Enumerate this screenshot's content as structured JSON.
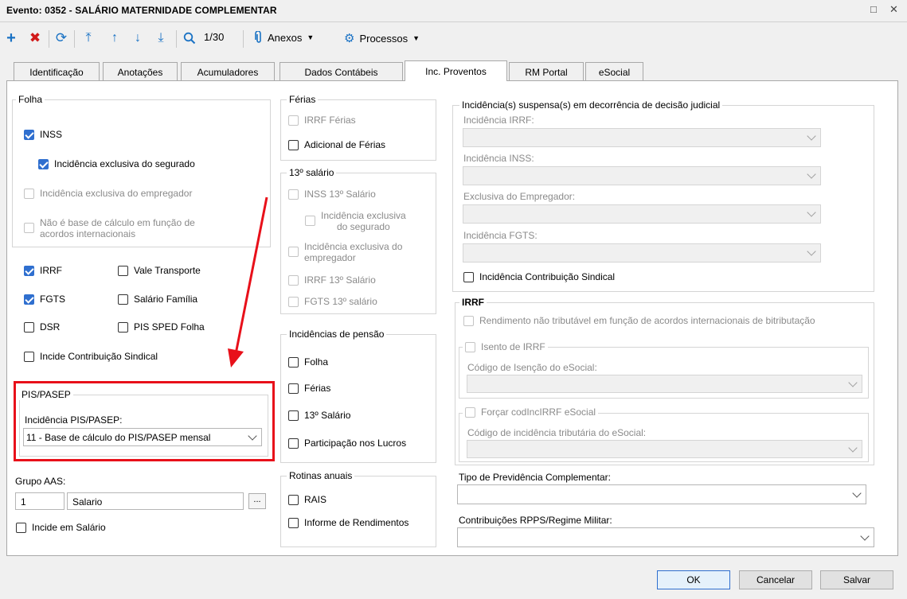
{
  "window": {
    "title": "Evento: 0352 - SALÁRIO MATERNIDADE COMPLEMENTAR",
    "restore_glyph": "□",
    "close_glyph": "✕"
  },
  "toolbar": {
    "page_counter": "1/30",
    "anexos": "Anexos",
    "processos": "Processos",
    "icons": [
      "plus-icon",
      "delete-icon",
      "refresh-icon",
      "first-icon",
      "previous-icon",
      "next-icon",
      "last-icon",
      "search-icon",
      "attachment-icon",
      "gear-icon"
    ]
  },
  "tabs": [
    "Identificação",
    "Anotações",
    "Acumuladores",
    "Dados Contábeis",
    "Inc. Proventos",
    "RM Portal",
    "eSocial"
  ],
  "active_tab": "Inc. Proventos",
  "folha": {
    "title": "Folha",
    "inss": "INSS",
    "inss_exclusiva_segurado": "Incidência exclusiva do segurado",
    "inss_exclusiva_empregador": "Incidência exclusiva do empregador",
    "nao_base_line1": "Não é base de cálculo em função de",
    "nao_base_line2": "acordos internacionais",
    "irrf": "IRRF",
    "vale_transporte": "Vale Transporte",
    "fgts": "FGTS",
    "salario_familia": "Salário Família",
    "dsr": "DSR",
    "pis_sped_folha": "PIS SPED Folha",
    "incide_contribuicao_sindical": "Incide Contribuição Sindical"
  },
  "pis_pasep": {
    "title": "PIS/PASEP",
    "label": "Incidência PIS/PASEP:",
    "value": "11 - Base de cálculo do PIS/PASEP mensal"
  },
  "grupo_aas": {
    "label": "Grupo AAS:",
    "code": "1",
    "name": "Salario",
    "browse": "...",
    "incide_salario": "Incide em Salário"
  },
  "ferias": {
    "title": "Férias",
    "irrf_ferias": "IRRF Férias",
    "adicional_ferias": "Adicional de Férias"
  },
  "decimo_terceiro": {
    "title": "13º salário",
    "inss_13": "INSS 13º Salário",
    "exclusiva_segurado_line1": "Incidência exclusiva",
    "exclusiva_segurado_line2": "do segurado",
    "exclusiva_empregador_line1": "Incidência exclusiva do",
    "exclusiva_empregador_line2": "empregador",
    "irrf_13": "IRRF 13º Salário",
    "fgts_13": "FGTS 13º salário"
  },
  "pensao": {
    "title": "Incidências de pensão",
    "folha": "Folha",
    "ferias": "Férias",
    "decimo": "13º Salário",
    "participacao_lucros": "Participação nos Lucros"
  },
  "rotinas": {
    "title": "Rotinas anuais",
    "rais": "RAIS",
    "informe_rendimentos": "Informe de Rendimentos"
  },
  "suspensa": {
    "title": "Incidência(s) suspensa(s) em decorrência de decisão judicial",
    "irrf": "Incidência IRRF:",
    "inss": "Incidência INSS:",
    "exclusiva_empregador": "Exclusiva do Empregador:",
    "fgts": "Incidência FGTS:",
    "contribuicao_sindical": "Incidência Contribuição Sindical"
  },
  "irrf_group": {
    "title": "IRRF",
    "rendimento_nao_tributavel": "Rendimento não tributável em função de acordos internacionais de bitributação",
    "isento_irrf": "Isento de IRRF",
    "codigo_isencao": "Código de Isenção do eSocial:",
    "forcar_cod": "Forçar codIncIRRF eSocial",
    "codigo_incidencia": "Código de incidência tributária do eSocial:"
  },
  "previdencia": {
    "label": "Tipo de Previdência Complementar:",
    "value": ""
  },
  "rpps": {
    "label": "Contribuições RPPS/Regime Militar:",
    "value": ""
  },
  "buttons": {
    "ok": "OK",
    "cancelar": "Cancelar",
    "salvar": "Salvar"
  },
  "colors": {
    "highlight": "#e8101a",
    "checkbox_checked": "#2f6fcf",
    "delete_icon": "#d11a1a",
    "plus_icon": "#1a72c4"
  }
}
